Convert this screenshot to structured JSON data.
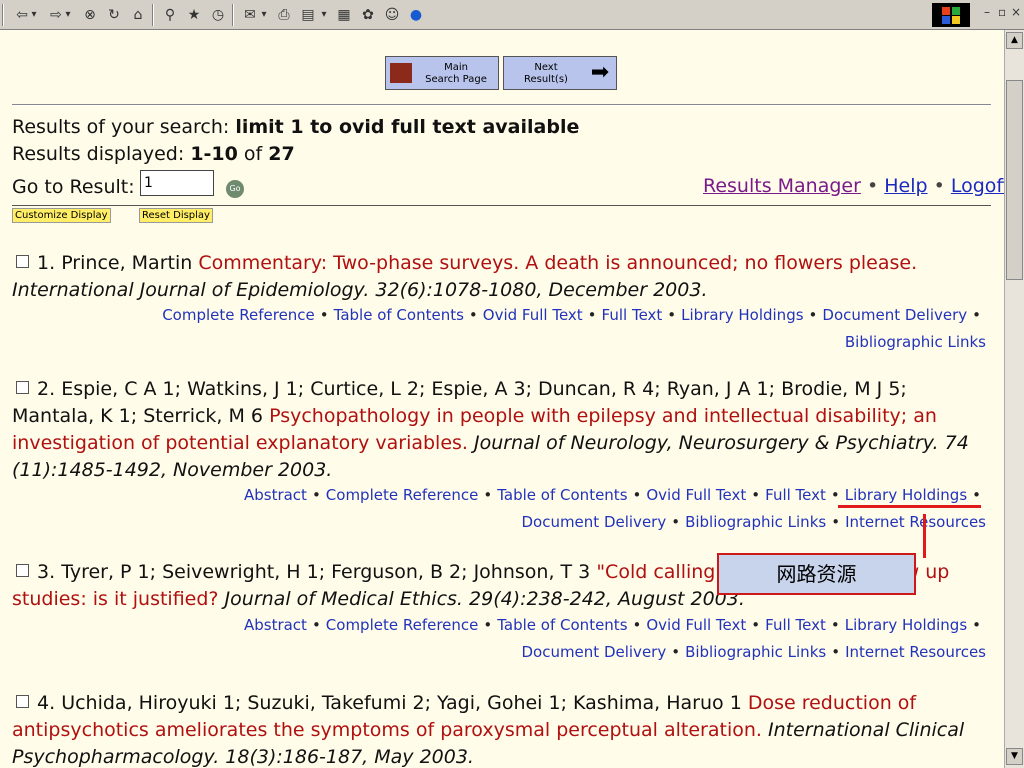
{
  "toolbar": {
    "icons": [
      "back-arrow",
      "back-dropdown",
      "forward-arrow",
      "forward-dropdown",
      "stop",
      "refresh",
      "home",
      "search",
      "favorites",
      "history",
      "mail",
      "print",
      "edit",
      "discuss",
      "notes",
      "messenger",
      "emoji",
      "blue"
    ],
    "arrow_back": "⇦",
    "arrow_fwd": "⇨",
    "dropdown": "▾",
    "stop": "⊗",
    "refresh": "↻",
    "home": "⌂",
    "search": "⚲",
    "favorites": "★",
    "history": "◷",
    "mail": "✉",
    "print": "⎙",
    "edit": "▤",
    "notes": "▦",
    "plugin": "✿",
    "emoji": "☺",
    "blue": "●",
    "win_min": "–",
    "win_restore": "▫",
    "win_close": "×"
  },
  "nav": {
    "main_search_line1": "Main",
    "main_search_line2": "Search Page",
    "next_line1": "Next",
    "next_line2": "Result(s)",
    "next_arrow": "➡"
  },
  "summary": {
    "search_label": "Results of your search: ",
    "search_value": "limit 1 to ovid full text available",
    "displayed_label": "Results displayed: ",
    "displayed_value": "1-10",
    "displayed_of": " of ",
    "displayed_total": "27",
    "goto_label": "Go to Result:",
    "goto_value": "1",
    "go_button": "Go",
    "results_manager": "Results Manager",
    "help": "Help",
    "logoff": "Logoff",
    "bullet": " • "
  },
  "display_buttons": {
    "customize": "Customize Display",
    "reset": "Reset Display"
  },
  "results": [
    {
      "num": "1.",
      "authors": "Prince, Martin",
      "title": "Commentary: Two-phase surveys. A death is announced; no flowers please.",
      "citation": "International Journal of Epidemiology. 32(6):1078-1080, December 2003.",
      "links_row1": [
        "Complete Reference",
        "Table of Contents",
        "Ovid Full Text",
        "Full Text",
        "Library Holdings",
        "Document Delivery"
      ],
      "links_row2": [
        "Bibliographic Links"
      ]
    },
    {
      "num": "2.",
      "authors_line1": "Espie, C A 1; Watkins, J 1; Curtice, L 2; Espie, A 3; Duncan, R 4; Ryan, J A 1; Brodie, M J 5;",
      "authors_line2": "Mantala, K 1; Sterrick, M 6",
      "title_part1": "Psychopathology in people with epilepsy and intellectual disability; an",
      "title_part2": "investigation of potential explanatory variables.",
      "citation_part1": "Journal of Neurology, Neurosurgery & Psychiatry. 74",
      "citation_part2": "(11):1485-1492, November 2003.",
      "links_row1": [
        "Abstract",
        "Complete Reference",
        "Table of Contents",
        "Ovid Full Text",
        "Full Text",
        "Library Holdings"
      ],
      "links_row2": [
        "Document Delivery",
        "Bibliographic Links",
        "Internet Resources"
      ]
    },
    {
      "num": "3.",
      "authors": "Tyrer, P 1; Seivewright, H 1; Ferguson, B 2; Johnson, T 3",
      "title_part1": "\"Cold calling\" in psychiatric follow up",
      "title_part2": "studies: is it justified?",
      "citation": "Journal of Medical Ethics. 29(4):238-242, August 2003.",
      "links_row1": [
        "Abstract",
        "Complete Reference",
        "Table of Contents",
        "Ovid Full Text",
        "Full Text",
        "Library Holdings"
      ],
      "links_row2": [
        "Document Delivery",
        "Bibliographic Links",
        "Internet Resources"
      ]
    },
    {
      "num": "4.",
      "authors": "Uchida, Hiroyuki 1; Suzuki, Takefumi 2; Yagi, Gohei 1; Kashima, Haruo 1",
      "title_part1": "Dose reduction of",
      "title_part2": "antipsychotics ameliorates the symptoms of paroxysmal perceptual alteration.",
      "citation_part1": "International Clinical",
      "citation_part2": "Psychopharmacology. 18(3):186-187, May 2003."
    }
  ],
  "annotation": {
    "callout_text": "网路资源",
    "color": "#e01a1a"
  },
  "colors": {
    "background": "#fffcea",
    "title": "#b01010",
    "link": "#2233bb"
  }
}
